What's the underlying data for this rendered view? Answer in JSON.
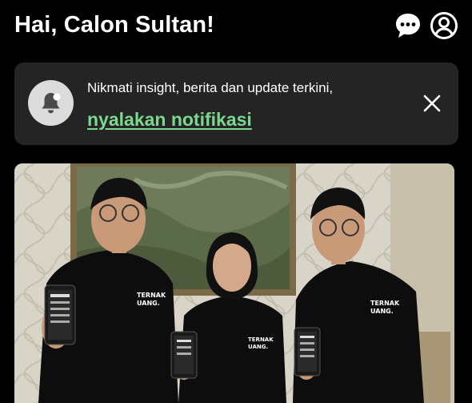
{
  "header": {
    "greeting": "Hai, Calon Sultan!",
    "icons": {
      "chat": "chat-bubble-icon",
      "profile": "profile-icon"
    }
  },
  "notification": {
    "message": "Nikmati insight, berita dan update terkini,",
    "link_text": "nyalakan notifikasi",
    "icons": {
      "bell": "bell-icon",
      "close": "close-icon"
    },
    "link_color": "#7bd88f"
  },
  "banner": {
    "shirt_text_1": "TERNAK",
    "shirt_text_2": "UANG."
  },
  "colors": {
    "background": "#000000",
    "card": "#242424",
    "accent_green": "#7bd88f"
  }
}
